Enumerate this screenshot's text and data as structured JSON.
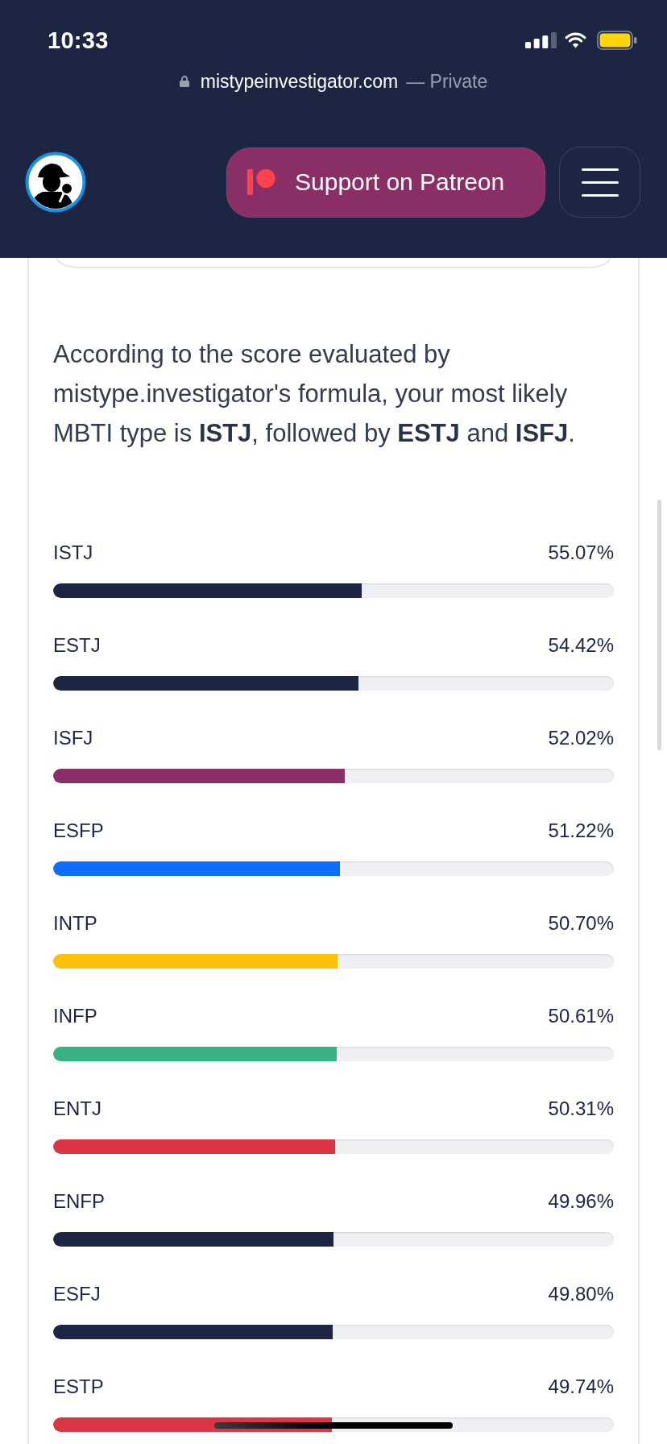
{
  "status_bar": {
    "time": "10:33"
  },
  "browser": {
    "url": "mistypeinvestigator.com",
    "mode": "— Private"
  },
  "nav": {
    "patreon_button": "Support on Patreon"
  },
  "summary": "According to the score evaluated by mistype.investigator's formula, your most likely MBTI type is **ISTJ**, followed by **ESTJ** and **ISFJ**.",
  "results": [
    {
      "type": "ISTJ",
      "percent": "55.07%",
      "level": 0.5507,
      "color": "#1c2541"
    },
    {
      "type": "ESTJ",
      "percent": "54.42%",
      "level": 0.5442,
      "color": "#1c2541"
    },
    {
      "type": "ISFJ",
      "percent": "52.02%",
      "level": 0.5202,
      "color": "#8a2f68"
    },
    {
      "type": "ESFP",
      "percent": "51.22%",
      "level": 0.5122,
      "color": "#0d6efd"
    },
    {
      "type": "INTP",
      "percent": "50.70%",
      "level": 0.507,
      "color": "#ffc107"
    },
    {
      "type": "INFP",
      "percent": "50.61%",
      "level": 0.5061,
      "color": "#38b183"
    },
    {
      "type": "ENTJ",
      "percent": "50.31%",
      "level": 0.5031,
      "color": "#dc3545"
    },
    {
      "type": "ENFP",
      "percent": "49.96%",
      "level": 0.4996,
      "color": "#1c2541"
    },
    {
      "type": "ESFJ",
      "percent": "49.80%",
      "level": 0.498,
      "color": "#1c2541"
    },
    {
      "type": "ESTP",
      "percent": "49.74%",
      "level": 0.4974,
      "color": "#dc3545"
    }
  ]
}
